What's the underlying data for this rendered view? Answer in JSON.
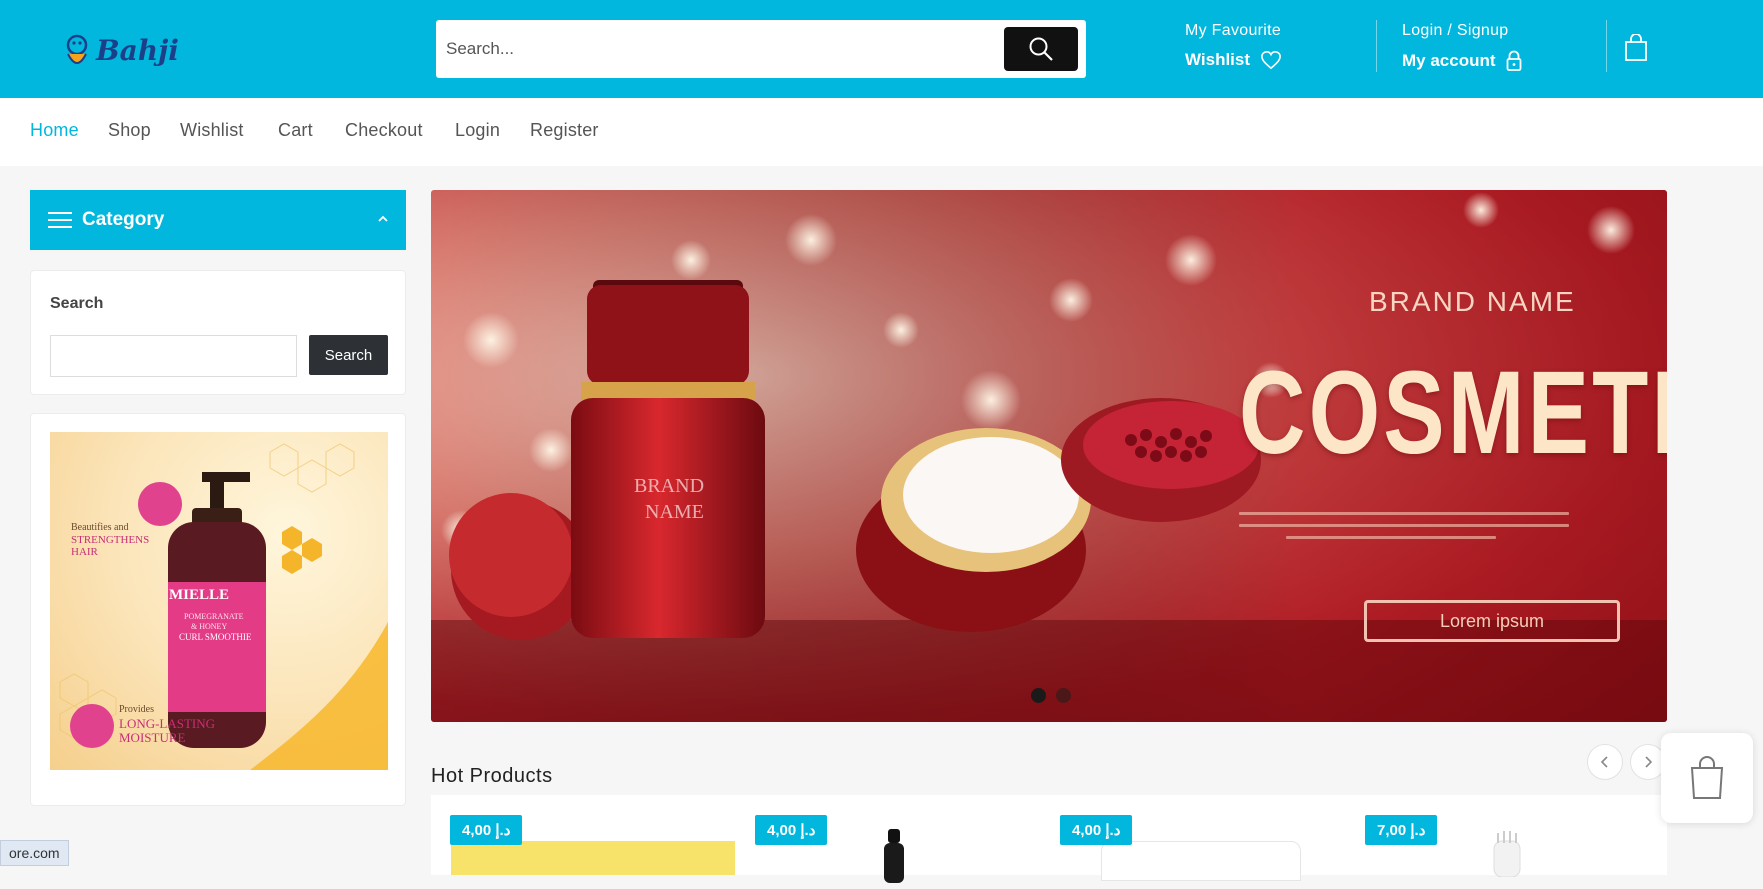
{
  "header": {
    "logo_text": "Bahji",
    "search_placeholder": "Search...",
    "favourite_small": "My Favourite",
    "favourite_big": "Wishlist",
    "account_small": "Login / Signup",
    "account_big": "My account"
  },
  "nav": {
    "items": [
      "Home",
      "Shop",
      "Wishlist",
      "Cart",
      "Checkout",
      "Login",
      "Register"
    ],
    "active": "Home"
  },
  "sidebar": {
    "category_label": "Category",
    "search_title": "Search",
    "search_button": "Search",
    "promo": {
      "line1": "Beautifies and",
      "line2": "STRENGTHENS",
      "line3": "HAIR",
      "brand": "MIELLE",
      "product_line1": "POMEGRANATE",
      "product_line2": "& HONEY",
      "product_line3": "CURL SMOOTHIE",
      "provides": "Provides",
      "bottom1": "LONG-LASTING",
      "bottom2": "MOISTURE"
    }
  },
  "hero": {
    "brand": "BRAND NAME",
    "title": "COSMETI",
    "bottle_label1": "BRAND",
    "bottle_label2": "NAME",
    "button": "Lorem ipsum",
    "slide_count": 2,
    "active_slide": 1
  },
  "hot_products": {
    "title": "Hot Products",
    "prices": [
      "4,00 د.إ",
      "4,00 د.إ",
      "4,00 د.إ",
      "7,00 د.إ"
    ]
  },
  "status_bar": {
    "url": "ore.com"
  },
  "colors": {
    "accent": "#01b7dd",
    "dark_button": "#111111",
    "sidebar_button": "#2d3135"
  }
}
